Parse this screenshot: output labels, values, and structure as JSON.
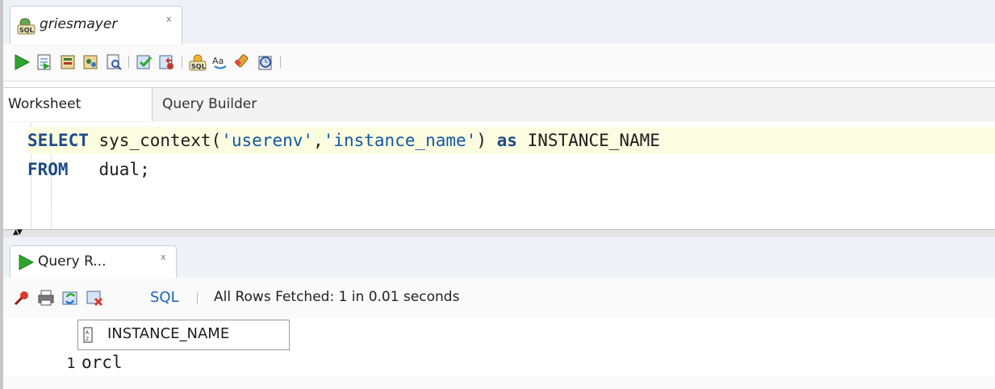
{
  "editor_tab": {
    "label": "griesmayer",
    "close": "x"
  },
  "subtabs": {
    "worksheet": "Worksheet",
    "query_builder": "Query Builder"
  },
  "code": {
    "line1": {
      "kw": "SELECT",
      "fn": " sys_context(",
      "s1": "'userenv'",
      "comma": ",",
      "s2": "'instance_name'",
      "close": ") ",
      "as": "as",
      "alias": " INSTANCE_NAME"
    },
    "line2": {
      "kw": "FROM",
      "rest": "   dual;"
    }
  },
  "results_tab": {
    "label": "Query R...",
    "close": "x"
  },
  "results_toolbar": {
    "sql_link": "SQL",
    "status": "All Rows Fetched: 1 in 0.01 seconds"
  },
  "grid": {
    "columns": [
      "INSTANCE_NAME"
    ],
    "rows": [
      {
        "num": "1",
        "values": [
          "orcl"
        ]
      }
    ]
  },
  "icons": {
    "toolbar": [
      "run-statement-icon",
      "run-script-icon",
      "autotrace-icon",
      "explain-plan-icon",
      "sql-tuning-icon",
      "commit-icon",
      "rollback-icon",
      "unshared-sql-icon",
      "to-upper-lower-icon",
      "clear-icon",
      "history-icon"
    ],
    "results_toolbar": [
      "pin-icon",
      "print-icon",
      "refresh-icon",
      "freeze-icon"
    ]
  },
  "colors": {
    "keyword": "#1f4b86",
    "string": "#1357a6",
    "highlight_line": "#fcfce1",
    "run_green": "#2ea52e",
    "link": "#1d5fbf"
  }
}
